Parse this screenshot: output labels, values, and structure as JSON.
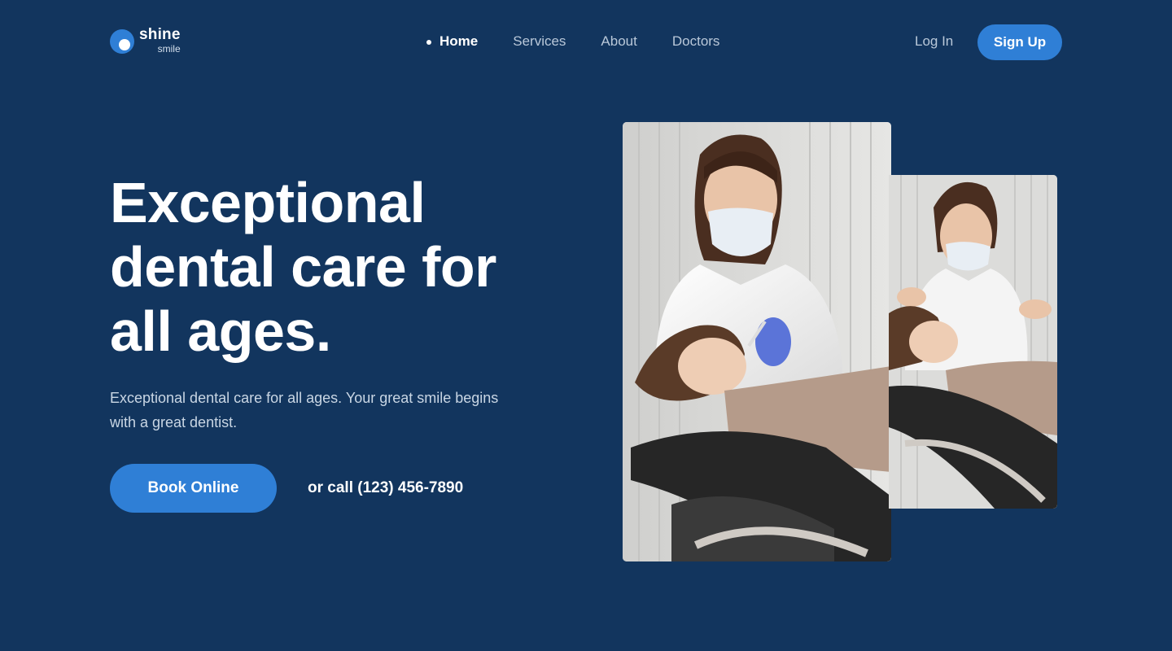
{
  "brand": {
    "name": "shine",
    "sub": "smile",
    "accent": "#2f7fd6",
    "background": "#12355e"
  },
  "nav": {
    "items": [
      {
        "label": "Home",
        "active": true
      },
      {
        "label": "Services",
        "active": false
      },
      {
        "label": "About",
        "active": false
      },
      {
        "label": "Doctors",
        "active": false
      }
    ]
  },
  "auth": {
    "login_label": "Log In",
    "signup_label": "Sign Up"
  },
  "hero": {
    "title_lines": [
      "Exceptional",
      "dental care for",
      "all ages."
    ],
    "subtitle": "Exceptional dental care for all ages. Your great smile begins with a great dentist.",
    "cta_label": "Book Online",
    "phone_text": "or call (123) 456-7890"
  },
  "images": {
    "main": "photo-dentist-treating-patient",
    "side": "photo-dentist-talking-to-patient"
  }
}
